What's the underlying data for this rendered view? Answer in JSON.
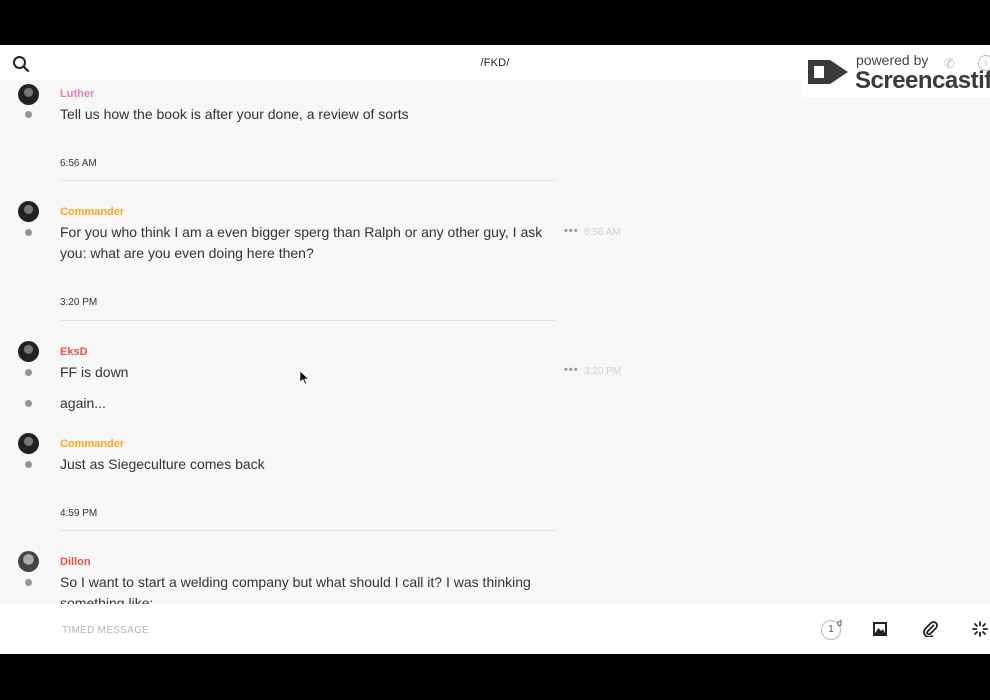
{
  "header": {
    "channel_title": "/FKD/"
  },
  "watermark": {
    "powered_by": "powered by",
    "brand": "Screencastify",
    "info": "i"
  },
  "messages": [
    {
      "author": "Luther",
      "color": "#e17ccd",
      "lines": [
        "Tell us how the book is after your done, a review of sorts"
      ]
    },
    {
      "divider_time": "6:56 AM"
    },
    {
      "author": "Commander",
      "color": "#f5a623",
      "lines": [
        "For you who think I am a even bigger sperg than Ralph or any other guy, I ask you: what are you even doing here then?"
      ],
      "menu": "•••",
      "time": "6:56 AM"
    },
    {
      "divider_time": "3:20 PM"
    },
    {
      "author": "EksD",
      "color": "#e5534b",
      "lines": [
        "FF is down",
        "again..."
      ],
      "menu": "•••",
      "time": "3:20 PM"
    },
    {
      "author": "Commander",
      "color": "#f5a623",
      "lines": [
        "Just as Siegeculture comes back"
      ]
    },
    {
      "divider_time": "4:59 PM"
    },
    {
      "author": "Dillon",
      "color": "#e5534b",
      "lines": [
        "So I want to start a welding company but what should I call it? I was thinking something like:"
      ]
    }
  ],
  "composer": {
    "placeholder": "TIMED MESSAGE",
    "timer_value": "1",
    "timer_unit": "d"
  },
  "icons": {
    "search": "search-icon",
    "image": "image-icon",
    "attach": "paperclip-icon",
    "more": "sparkle-icon"
  }
}
